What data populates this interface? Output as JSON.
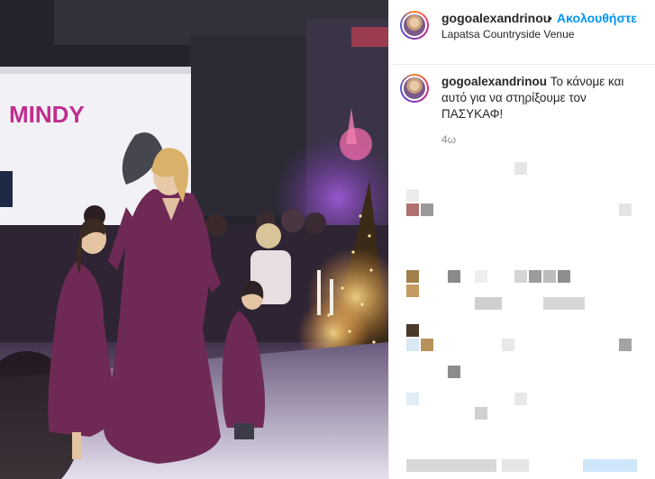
{
  "post": {
    "username": "gogoalexandrinou",
    "separator": "•",
    "follow_label": "Ακολουθήστε",
    "location": "Lapatsa Countryside Venue"
  },
  "caption": {
    "username": "gogoalexandrinou",
    "text": "Το κάνομε και αυτό για να στηρίξουμε τον ΠΑΣΥΚΑΦ!",
    "time": "4ω"
  },
  "media": {
    "screen_text": "MINDY"
  },
  "colors": {
    "accent": "#0095f6",
    "dress": "#6e2a55",
    "screen_text": "#c02d8f"
  }
}
